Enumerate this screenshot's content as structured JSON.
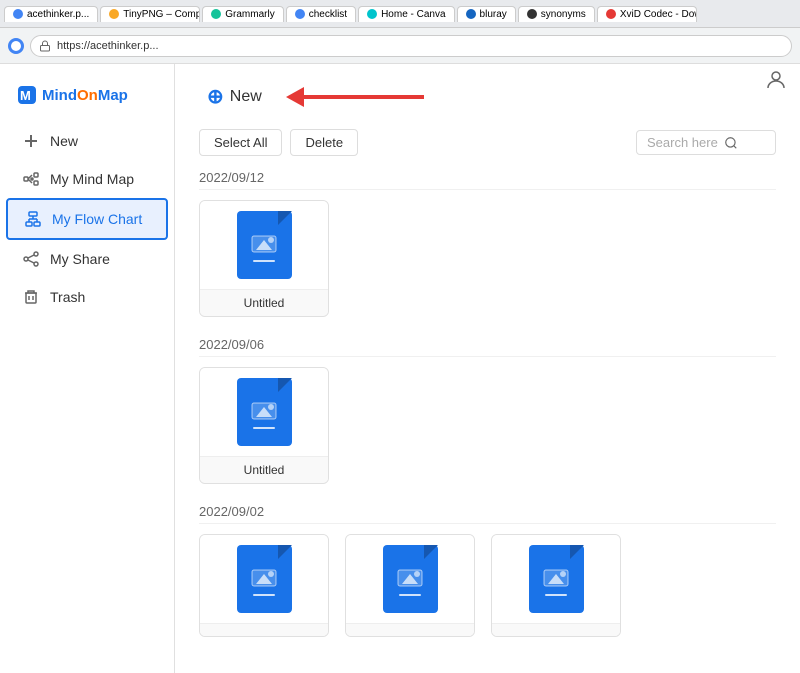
{
  "browser": {
    "url": "https://acethinker.p...",
    "tabs": [
      {
        "label": "TinyPNG – Compre...",
        "color": "#f9a825"
      },
      {
        "label": "Grammarly",
        "color": "#15c39a"
      },
      {
        "label": "checklist",
        "color": "#4285f4"
      },
      {
        "label": "Home - Canva",
        "color": "#00c4cc"
      },
      {
        "label": "bluray",
        "color": "#1565c0"
      },
      {
        "label": "synonyms",
        "color": "#333"
      },
      {
        "label": "XviD Codec - Down...",
        "color": "#e53935"
      }
    ]
  },
  "sidebar": {
    "logo": "MindOnMap",
    "items": [
      {
        "id": "new",
        "label": "New",
        "icon": "plus"
      },
      {
        "id": "mindmap",
        "label": "My Mind Map",
        "icon": "mindmap"
      },
      {
        "id": "flowchart",
        "label": "My Flow Chart",
        "icon": "flowchart",
        "active": true
      },
      {
        "id": "share",
        "label": "My Share",
        "icon": "share"
      },
      {
        "id": "trash",
        "label": "Trash",
        "icon": "trash"
      }
    ]
  },
  "main": {
    "new_button_label": "New",
    "select_all_label": "Select All",
    "delete_label": "Delete",
    "search_placeholder": "Search here",
    "sections": [
      {
        "date": "2022/09/12",
        "files": [
          {
            "name": "Untitled"
          }
        ]
      },
      {
        "date": "2022/09/06",
        "files": [
          {
            "name": "Untitled"
          }
        ]
      },
      {
        "date": "2022/09/02",
        "files": [
          {
            "name": ""
          },
          {
            "name": ""
          },
          {
            "name": ""
          }
        ]
      }
    ]
  },
  "user_icon": "👤"
}
